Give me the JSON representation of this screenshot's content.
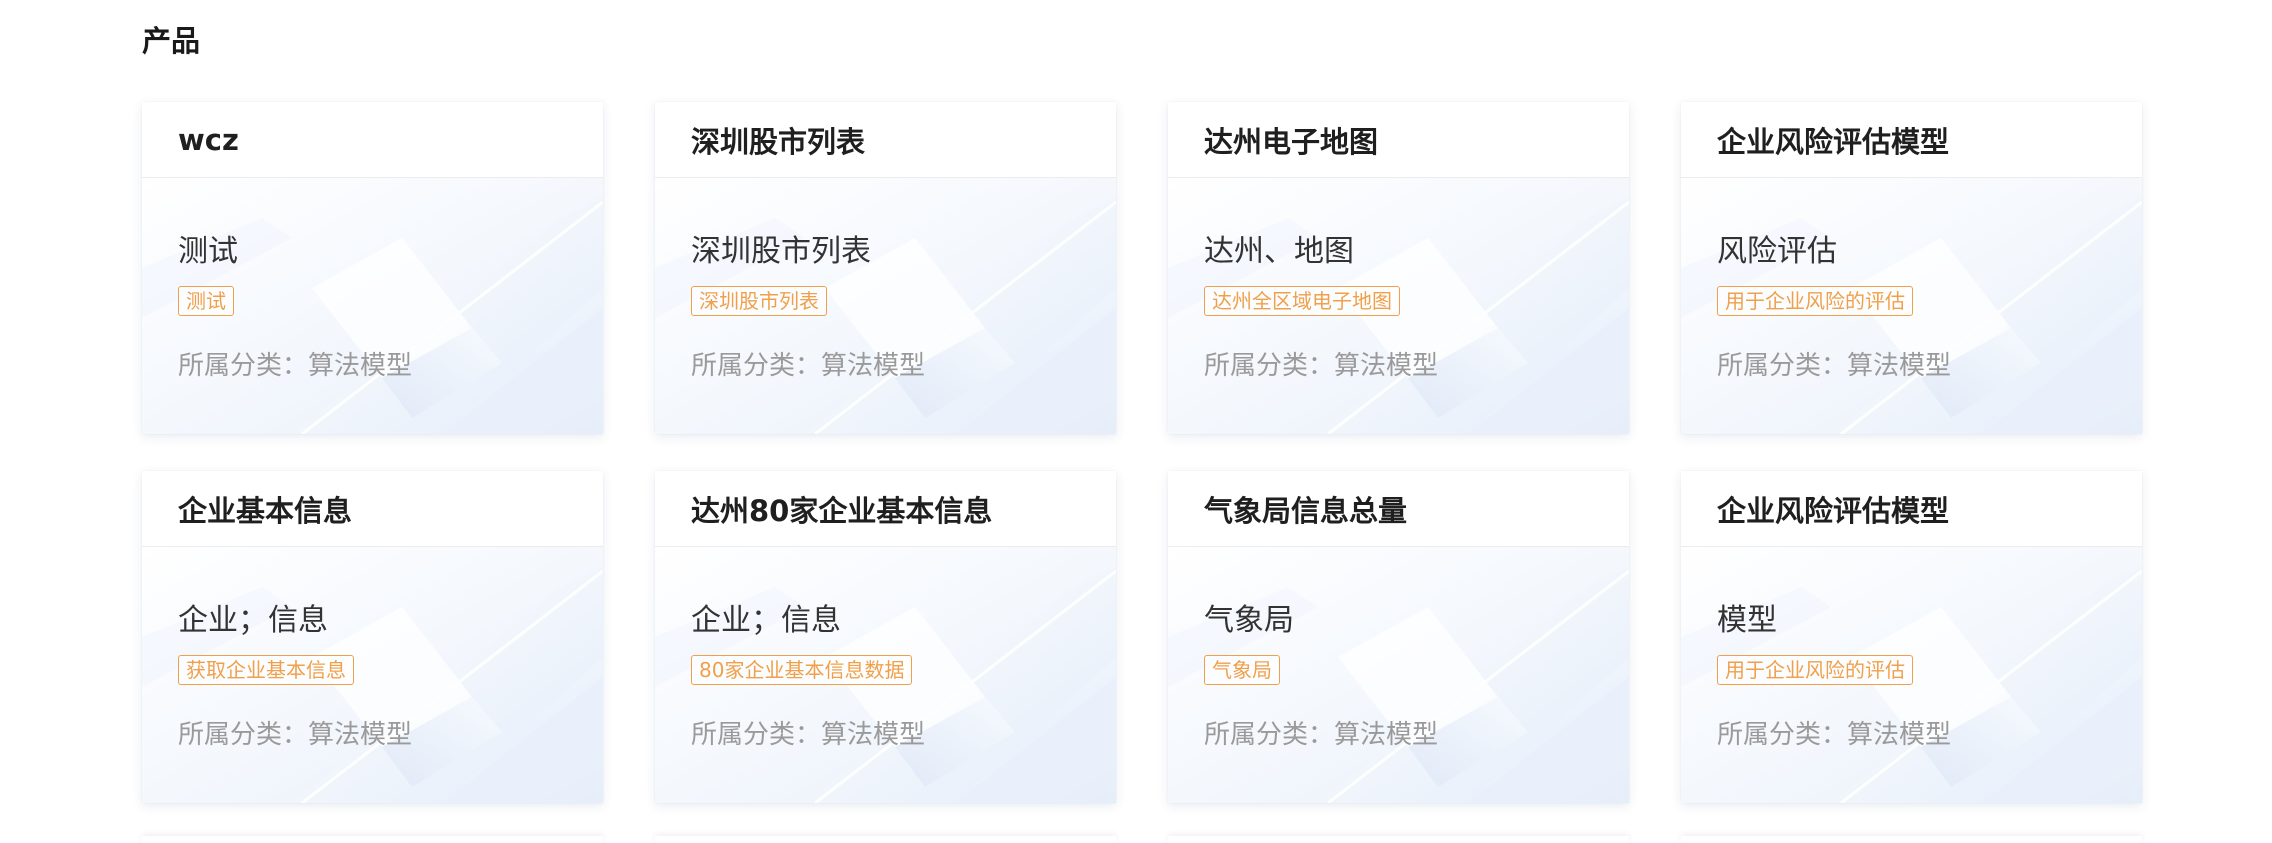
{
  "section": {
    "title": "产品"
  },
  "category_label": "所属分类：",
  "cards": [
    {
      "title": "wcz",
      "desc": "测试",
      "tag": "测试",
      "category": "算法模型"
    },
    {
      "title": "深圳股市列表",
      "desc": "深圳股市列表",
      "tag": "深圳股市列表",
      "category": "算法模型"
    },
    {
      "title": "达州电子地图",
      "desc": "达州、地图",
      "tag": "达州全区域电子地图",
      "category": "算法模型"
    },
    {
      "title": "企业风险评估模型",
      "desc": "风险评估",
      "tag": "用于企业风险的评估",
      "category": "算法模型"
    },
    {
      "title": "企业基本信息",
      "desc": "企业；信息",
      "tag": "获取企业基本信息",
      "category": "算法模型"
    },
    {
      "title": "达州80家企业基本信息",
      "desc": "企业；信息",
      "tag": "80家企业基本信息数据",
      "category": "算法模型"
    },
    {
      "title": "气象局信息总量",
      "desc": "气象局",
      "tag": "气象局",
      "category": "算法模型"
    },
    {
      "title": "企业风险评估模型",
      "desc": "模型",
      "tag": "用于企业风险的评估",
      "category": "算法模型"
    }
  ],
  "colors": {
    "tag_accent": "#f0a04b",
    "card_bg_tint": "#eef4fd",
    "muted_text": "#9a9a9a"
  }
}
